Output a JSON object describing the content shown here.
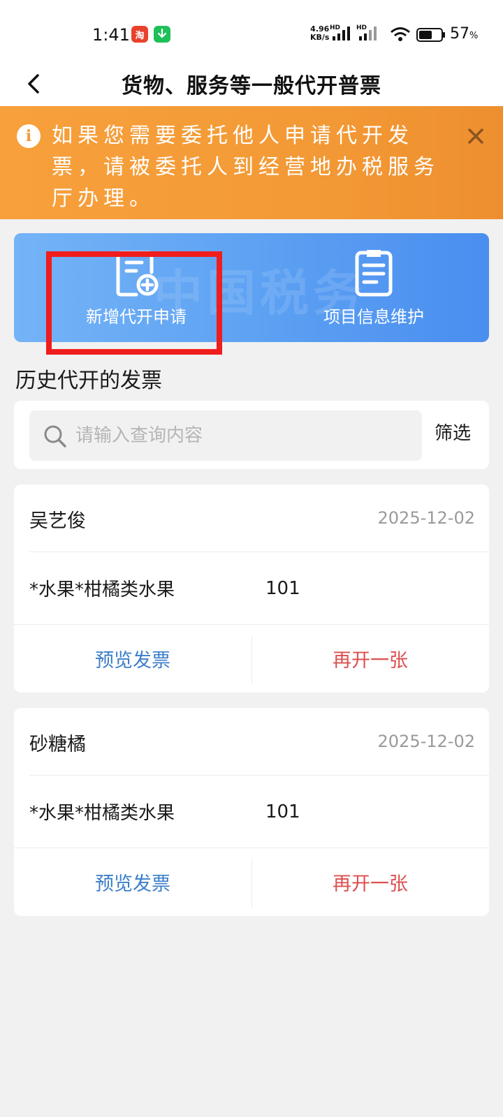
{
  "status_bar": {
    "time": "1:41",
    "app_icon_1": "taobao-icon",
    "app_icon_2": "download-icon",
    "net_speed_value": "4.96",
    "net_speed_unit": "KB/s",
    "signal_1_label": "HD",
    "signal_2_label": "HD",
    "battery_percent": "57",
    "battery_unit": "%"
  },
  "nav": {
    "title": "货物、服务等一般代开普票"
  },
  "notice": {
    "text": "如果您需要委托他人申请代开发票，请被委托人到经营地办税服务厅办理。",
    "icon": "info-icon"
  },
  "actions": [
    {
      "label": "新增代开申请",
      "icon": "add-document-icon"
    },
    {
      "label": "项目信息维护",
      "icon": "clipboard-list-icon"
    }
  ],
  "history": {
    "title": "历史代开的发票",
    "search_placeholder": "请输入查询内容",
    "filter_label": "筛选"
  },
  "invoices": [
    {
      "name": "吴艺俊",
      "date": "2025-12-02",
      "item": "*水果*柑橘类水果",
      "qty": "101",
      "preview_label": "预览发票",
      "reissue_label": "再开一张"
    },
    {
      "name": "砂糖橘",
      "date": "2025-12-02",
      "item": "*水果*柑橘类水果",
      "qty": "101",
      "preview_label": "预览发票",
      "reissue_label": "再开一张"
    }
  ],
  "colors": {
    "notice_bg": "#f39a36",
    "action_card_start": "#74b3f6",
    "action_card_end": "#4a8ef0",
    "highlight_box": "#f01d1d",
    "preview_link": "#3b7ec9",
    "reissue_link": "#dc4f4f"
  }
}
